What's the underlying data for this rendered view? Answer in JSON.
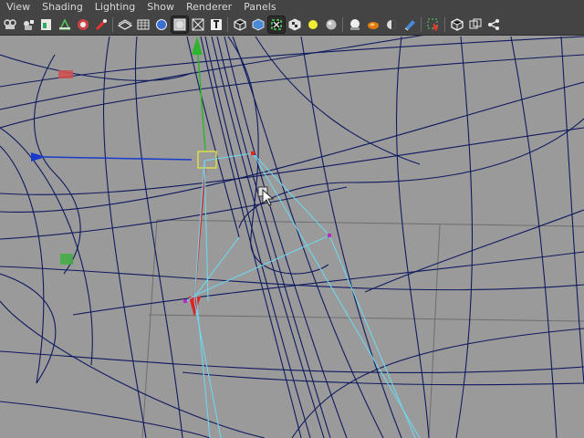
{
  "menus": [
    "View",
    "Shading",
    "Lighting",
    "Show",
    "Renderer",
    "Panels"
  ],
  "toolbar_icons": [
    "camera-select-icon",
    "camera-attributes-icon",
    "bookmark-icon",
    "image-plane-icon",
    "grid-toggle-icon",
    "film-gate-icon",
    "wireframe-mode-icon",
    "smooth-shade-icon",
    "wireframe-on-shaded-icon",
    "textured-icon",
    "use-all-lights-icon",
    "shadows-icon",
    "xray-icon",
    "xray-joints-icon",
    "isolate-select-icon",
    "textures-icon",
    "default-light-icon",
    "sphere-light-icon",
    "high-quality-icon",
    "ambient-occlusion-icon",
    "motion-blur-icon",
    "multisample-icon",
    "select-camera-icon",
    "single-view-icon",
    "two-view-icon",
    "share-icon"
  ],
  "colors": {
    "menubar_bg": "#444444",
    "viewport_bg": "#9a9a9a",
    "curve_color": "#0f1a5e",
    "selection_color": "#6fd6ee",
    "grid_color": "#6e6e6e"
  }
}
